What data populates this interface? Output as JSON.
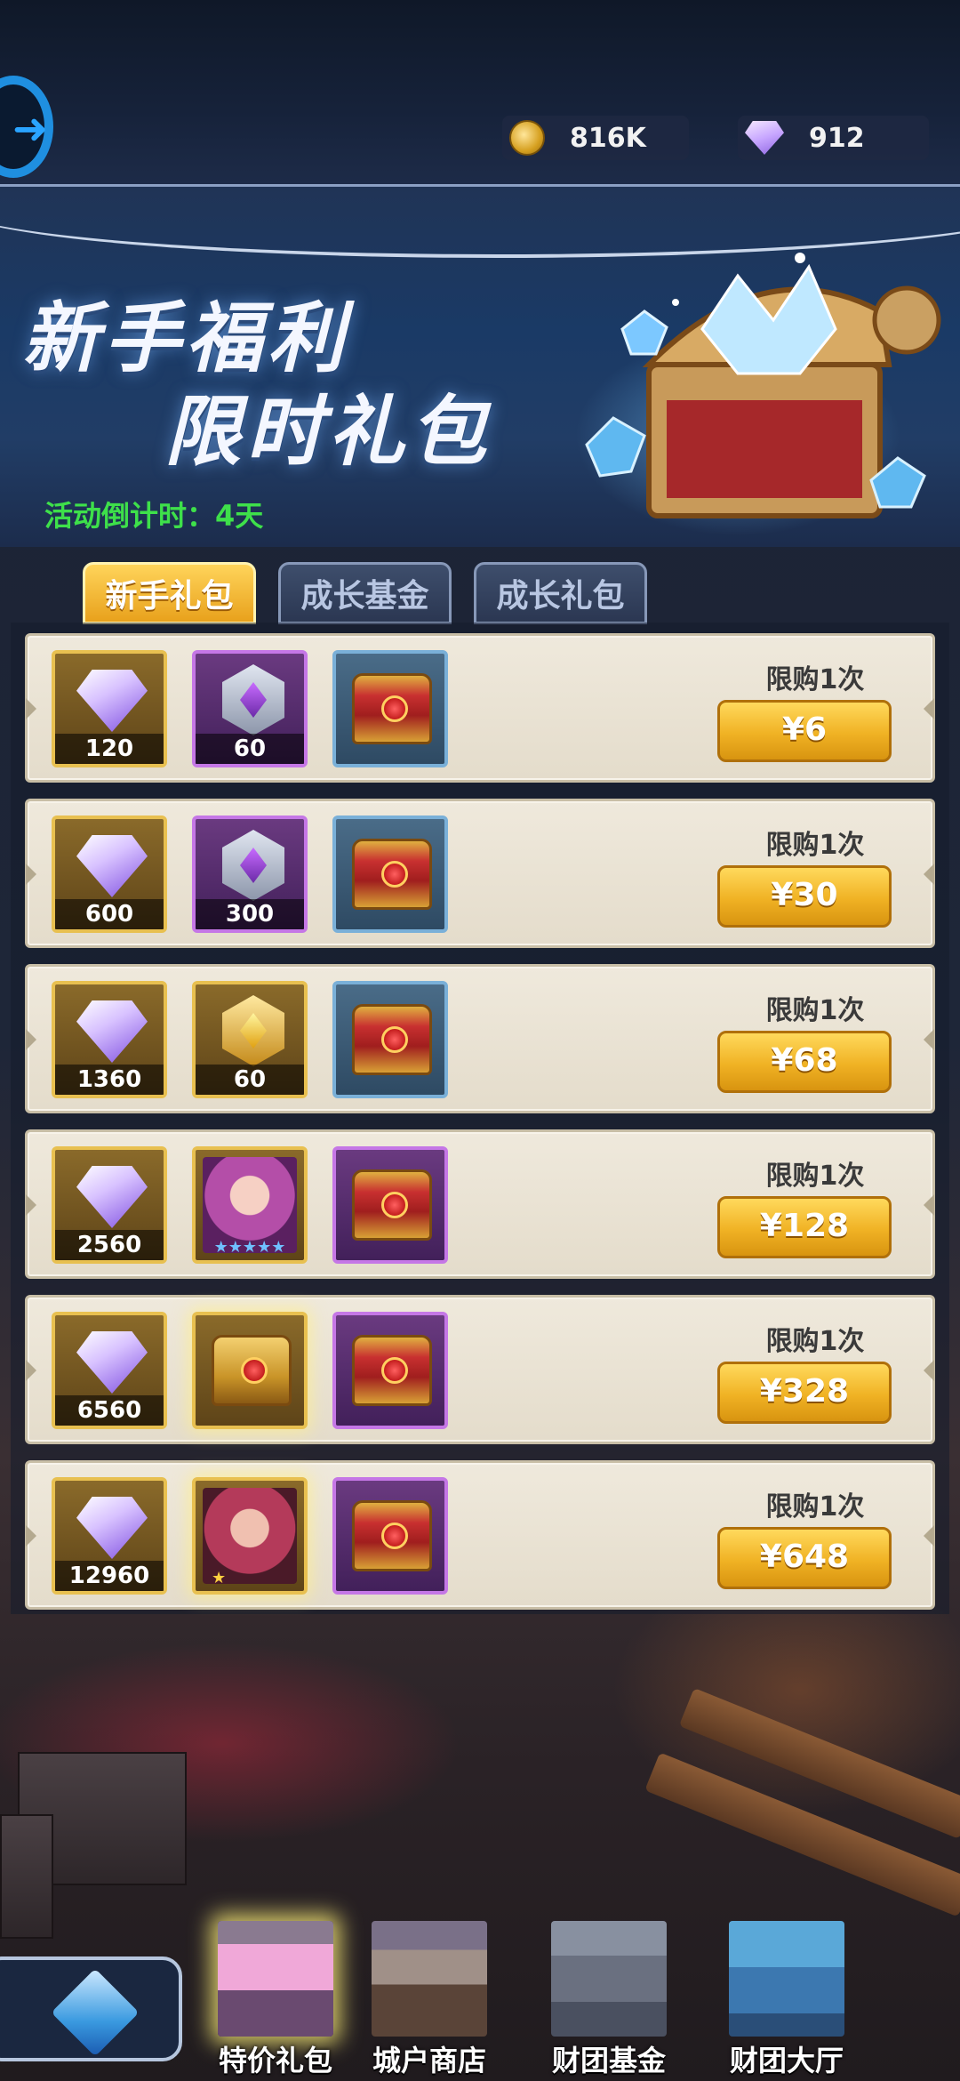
{
  "header": {
    "back_icon": "back-arrow-icon",
    "coins": {
      "icon": "gold-coin-icon",
      "value": "816K"
    },
    "gems": {
      "icon": "purple-gem-icon",
      "value": "912"
    }
  },
  "banner": {
    "title_line1": "新手福利",
    "title_line2": "限时礼包",
    "countdown": "活动倒计时：4天"
  },
  "tabs": [
    {
      "label": "新手礼包",
      "active": true
    },
    {
      "label": "成长基金",
      "active": false
    },
    {
      "label": "成长礼包",
      "active": false
    }
  ],
  "packs": [
    {
      "items": [
        {
          "type": "gem",
          "qty": "120"
        },
        {
          "type": "crest-silver",
          "qty": "60"
        },
        {
          "type": "chest",
          "qty": ""
        }
      ],
      "limit": "限购1次",
      "price": "¥6"
    },
    {
      "items": [
        {
          "type": "gem",
          "qty": "600"
        },
        {
          "type": "crest-silver",
          "qty": "300"
        },
        {
          "type": "chest",
          "qty": ""
        }
      ],
      "limit": "限购1次",
      "price": "¥30"
    },
    {
      "items": [
        {
          "type": "gem",
          "qty": "1360"
        },
        {
          "type": "crest-gold",
          "qty": "60"
        },
        {
          "type": "chest",
          "qty": ""
        }
      ],
      "limit": "限购1次",
      "price": "¥68"
    },
    {
      "items": [
        {
          "type": "gem",
          "qty": "2560"
        },
        {
          "type": "hero-portrait",
          "stars": "★★★★★"
        },
        {
          "type": "chest",
          "qty": ""
        }
      ],
      "limit": "限购1次",
      "price": "¥128"
    },
    {
      "items": [
        {
          "type": "gem",
          "qty": "6560"
        },
        {
          "type": "gold-chest",
          "qty": ""
        },
        {
          "type": "chest",
          "qty": ""
        }
      ],
      "limit": "限购1次",
      "price": "¥328"
    },
    {
      "items": [
        {
          "type": "gem",
          "qty": "12960"
        },
        {
          "type": "hero-portrait",
          "stars": "★"
        },
        {
          "type": "chest",
          "qty": ""
        }
      ],
      "limit": "限购1次",
      "price": "¥648"
    }
  ],
  "bottom_nav": [
    {
      "label": "特价礼包",
      "active": true
    },
    {
      "label": "城户商店",
      "active": false
    },
    {
      "label": "财团基金",
      "active": false
    },
    {
      "label": "财团大厅",
      "active": false
    }
  ],
  "colors": {
    "accent_gold": "#f0b224",
    "countdown_green": "#3ee04a",
    "tab_active": "#ffd45a"
  }
}
